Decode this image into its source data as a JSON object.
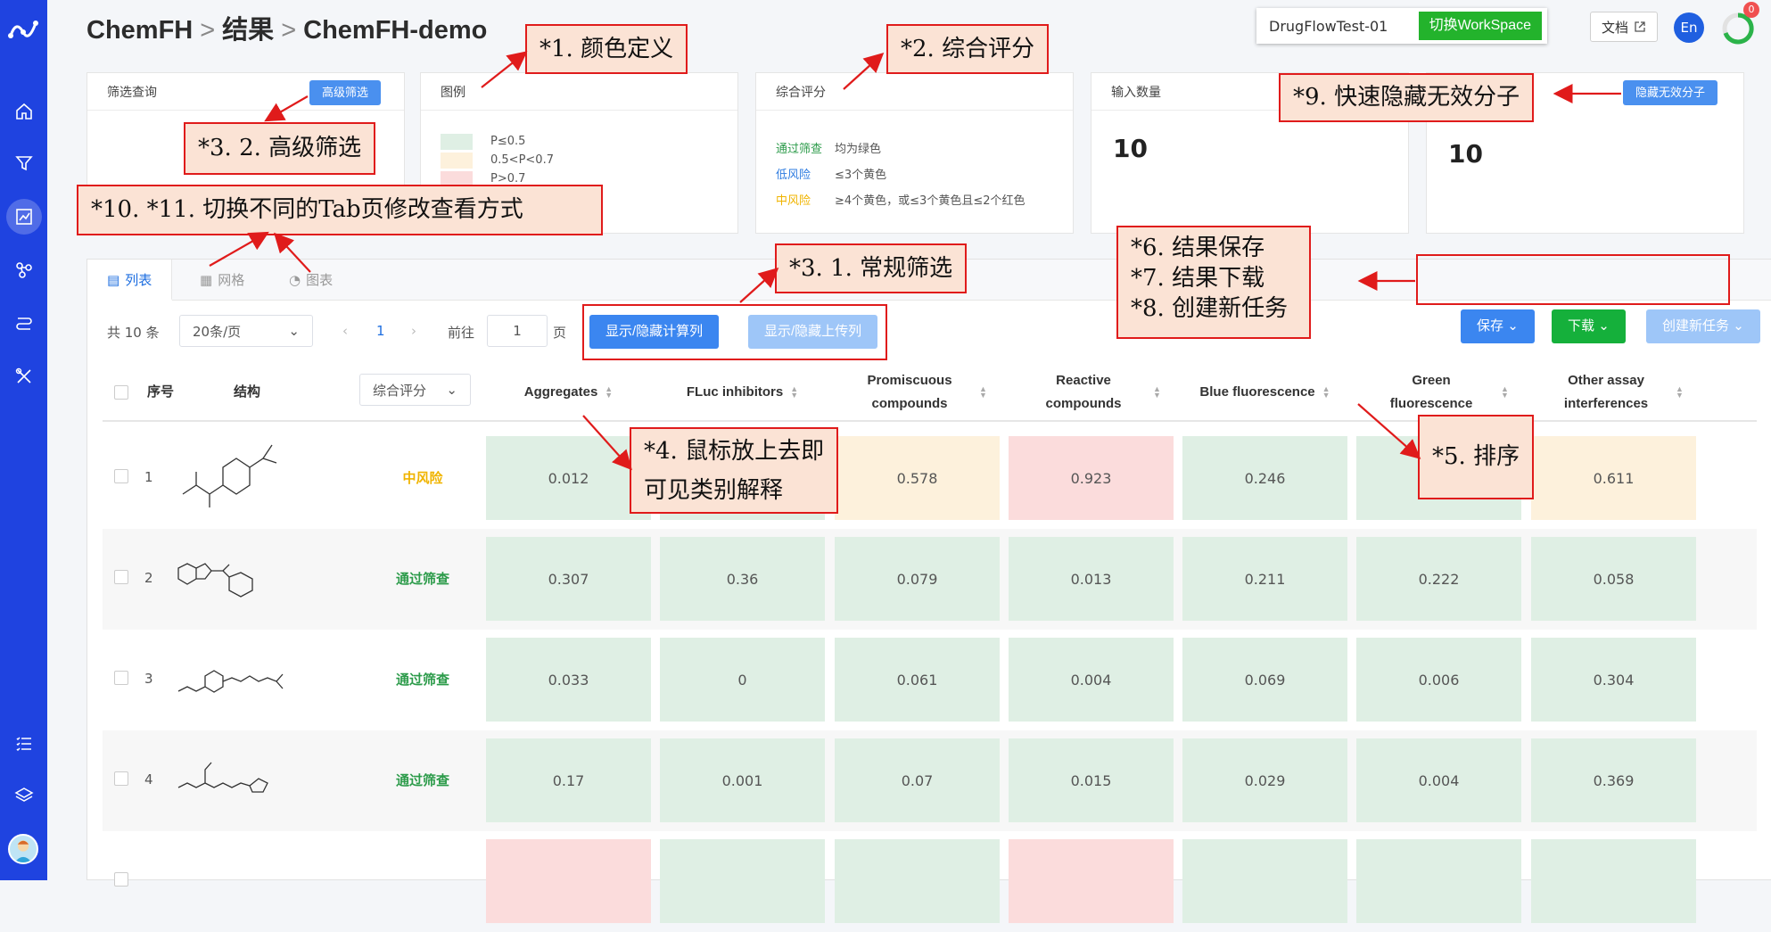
{
  "breadcrumb": {
    "root": "ChemFH",
    "sep1": ">",
    "mid": "结果",
    "sep2": ">",
    "current": "ChemFH-demo"
  },
  "header": {
    "workspace_name": "DrugFlowTest-01",
    "switch_label": "切换WorkSpace",
    "docs_label": "文档",
    "lang_label": "En",
    "notification_count": "0"
  },
  "cards": {
    "filter": {
      "title": "筛选查询",
      "button": "高级筛选"
    },
    "legend": {
      "title": "图例",
      "items": [
        "P≤0.5",
        "0.5<P<0.7",
        "P>0.7"
      ],
      "colors": [
        "#dfefe4",
        "#fdf1dc",
        "#fbdcdc"
      ]
    },
    "score": {
      "title": "综合评分",
      "rows": [
        {
          "label": "通过筛查",
          "desc": "均为绿色",
          "color": "#2c9b4a"
        },
        {
          "label": "低风险",
          "desc": "≤3个黄色",
          "color": "#2f7ce0"
        },
        {
          "label": "中风险",
          "desc": "≥4个黄色，或≤3个黄色且≤2个红色",
          "color": "#f0b400"
        }
      ]
    },
    "input": {
      "title": "输入数量",
      "value": "10"
    },
    "valid": {
      "button": "隐藏无效分子",
      "value": "10"
    }
  },
  "tabs": [
    {
      "label": "列表"
    },
    {
      "label": "网格"
    },
    {
      "label": "图表"
    }
  ],
  "toolbar": {
    "total": "共 10 条",
    "page_size": "20条/页",
    "current_page": "1",
    "goto_label": "前往",
    "goto_value": "1",
    "page_unit": "页",
    "toggle_calc": "显示/隐藏计算列",
    "toggle_upload": "显示/隐藏上传列",
    "save": "保存",
    "download": "下载",
    "new_task": "创建新任务"
  },
  "table": {
    "headers": {
      "index": "序号",
      "structure": "结构",
      "score": "综合评分",
      "cols": [
        "Aggregates",
        "FLuc inhibitors",
        "Promiscuous compounds",
        "Reactive compounds",
        "Blue fluorescence",
        "Green fluorescence",
        "Other assay interferences"
      ]
    },
    "rows": [
      {
        "no": "1",
        "risk": "中风险",
        "risk_color": "#f0b400",
        "values": [
          "0.012",
          "",
          "0.578",
          "0.923",
          "0.246",
          "",
          "0.611"
        ],
        "colors": [
          "g",
          "g",
          "y",
          "r",
          "g",
          "g",
          "y"
        ]
      },
      {
        "no": "2",
        "risk": "通过筛查",
        "risk_color": "#2c9b4a",
        "values": [
          "0.307",
          "0.36",
          "0.079",
          "0.013",
          "0.211",
          "0.222",
          "0.058"
        ],
        "colors": [
          "g",
          "g",
          "g",
          "g",
          "g",
          "g",
          "g"
        ]
      },
      {
        "no": "3",
        "risk": "通过筛查",
        "risk_color": "#2c9b4a",
        "values": [
          "0.033",
          "0",
          "0.061",
          "0.004",
          "0.069",
          "0.006",
          "0.304"
        ],
        "colors": [
          "g",
          "g",
          "g",
          "g",
          "g",
          "g",
          "g"
        ]
      },
      {
        "no": "4",
        "risk": "通过筛查",
        "risk_color": "#2c9b4a",
        "values": [
          "0.17",
          "0.001",
          "0.07",
          "0.015",
          "0.029",
          "0.004",
          "0.369"
        ],
        "colors": [
          "g",
          "g",
          "g",
          "g",
          "g",
          "g",
          "g"
        ]
      },
      {
        "no": "",
        "risk": "",
        "risk_color": "#2c9b4a",
        "values": [
          "",
          "",
          "",
          "",
          "",
          "",
          ""
        ],
        "colors": [
          "r",
          "g",
          "g",
          "r",
          "g",
          "g",
          "g"
        ]
      }
    ]
  },
  "annotations": {
    "a1": "*1. 颜色定义",
    "a2": "*2. 综合评分",
    "a32": "*3. 2. 高级筛选",
    "a10": "*10. *11. 切换不同的Tab页修改查看方式",
    "a31": "*3. 1. 常规筛选",
    "a4_l1": "*4. 鼠标放上去即",
    "a4_l2": "可见类别解释",
    "a5": "*5. 排序",
    "a6": "*6. 结果保存",
    "a7": "*7. 结果下载",
    "a8": "*8. 创建新任务",
    "a9": "*9. 快速隐藏无效分子"
  },
  "icons": {
    "sidebar": [
      "home-icon",
      "filter-icon",
      "chart-icon",
      "molecule-icon",
      "flow-icon",
      "tools-icon",
      "task-list-icon",
      "layers-icon"
    ]
  },
  "colors": {
    "accent": "#1f43e0",
    "green_cell": "#dfefe4",
    "yellow_cell": "#fdf1dc",
    "red_cell": "#fbdcdc",
    "annotation_bg": "#fbe3d5",
    "annotation_border": "#e01b1b"
  }
}
